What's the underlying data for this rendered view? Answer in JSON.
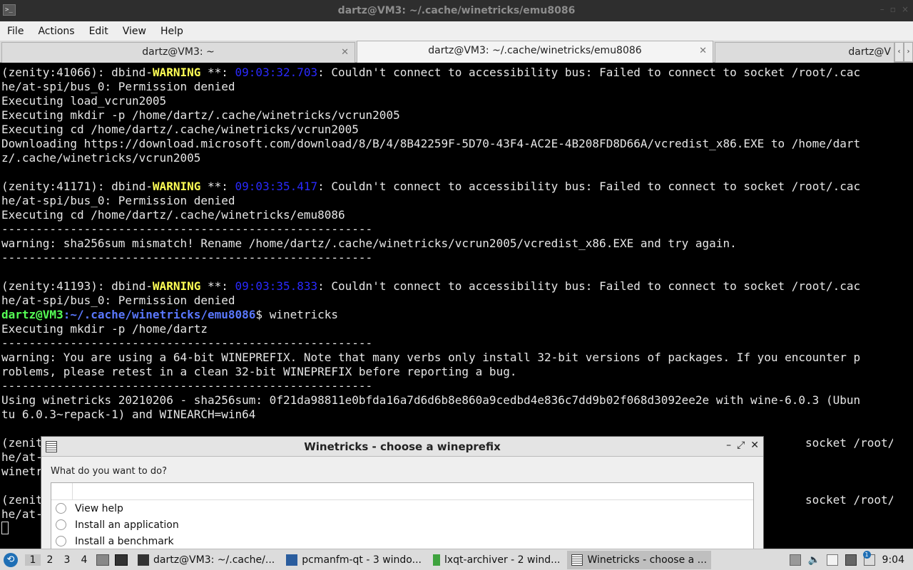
{
  "window": {
    "title": "dartz@VM3: ~/.cache/winetricks/emu8086",
    "buttons": [
      "–",
      "▫",
      "×"
    ]
  },
  "menu": [
    "File",
    "Actions",
    "Edit",
    "View",
    "Help"
  ],
  "tabs": [
    {
      "label": "dartz@VM3: ~",
      "active": false
    },
    {
      "label": "dartz@VM3: ~/.cache/winetricks/emu8086",
      "active": true
    },
    {
      "label": "dartz@V",
      "active": false
    }
  ],
  "terminal": {
    "lines": [
      "(zenity:41066): dbind-|WARNING| **: |09:03:32.703|: Couldn't connect to accessibility bus: Failed to connect to socket /root/.cac",
      "he/at-spi/bus_0: Permission denied",
      "Executing load_vcrun2005",
      "Executing mkdir -p /home/dartz/.cache/winetricks/vcrun2005",
      "Executing cd /home/dartz/.cache/winetricks/vcrun2005",
      "Downloading https://download.microsoft.com/download/8/B/4/8B42259F-5D70-43F4-AC2E-4B208FD8D66A/vcredist_x86.EXE to /home/dart",
      "z/.cache/winetricks/vcrun2005",
      "",
      "(zenity:41171): dbind-|WARNING| **: |09:03:35.417|: Couldn't connect to accessibility bus: Failed to connect to socket /root/.cac",
      "he/at-spi/bus_0: Permission denied",
      "Executing cd /home/dartz/.cache/winetricks/emu8086",
      "------------------------------------------------------",
      "warning: sha256sum mismatch! Rename /home/dartz/.cache/winetricks/vcrun2005/vcredist_x86.EXE and try again.",
      "------------------------------------------------------",
      "",
      "(zenity:41193): dbind-|WARNING| **: |09:03:35.833|: Couldn't connect to accessibility bus: Failed to connect to socket /root/.cac",
      "he/at-spi/bus_0: Permission denied",
      "PROMPT",
      "Executing mkdir -p /home/dartz",
      "------------------------------------------------------",
      "warning: You are using a 64-bit WINEPREFIX. Note that many verbs only install 32-bit versions of packages. If you encounter p",
      "roblems, please retest in a clean 32-bit WINEPREFIX before reporting a bug.",
      "------------------------------------------------------",
      "Using winetricks 20210206 - sha256sum: 0f21da98811e0bfda16a7d6d6b8e860a9cedbd4e836c7dd9b02f068d3092ee2e with wine-6.0.3 (Ubun",
      "tu 6.0.3~repack-1) and WINEARCH=win64",
      "",
      "(zenit                                                                                                               socket /root/.cac",
      "he/at-                                                                                                                           ",
      "winetr",
      "",
      "(zenit                                                                                                               socket /root/.cac",
      "he/at-"
    ],
    "prompt": {
      "user_host": "dartz@VM3",
      "path": ":~/.cache/winetricks/emu8086",
      "symbol": "$ ",
      "command": "winetricks"
    }
  },
  "dialog": {
    "title": "Winetricks - choose a wineprefix",
    "prompt": "What do you want to do?",
    "buttons": [
      "–",
      "⤢",
      "✕"
    ],
    "options": [
      "View help",
      "Install an application",
      "Install a benchmark"
    ]
  },
  "taskbar": {
    "desktops": [
      "1",
      "2",
      "3",
      "4"
    ],
    "tasks": [
      {
        "label": "dartz@VM3: ~/.cache/...",
        "icon": "terminal-icon",
        "active": false
      },
      {
        "label": "pcmanfm-qt - 3 windo...",
        "icon": "folder-icon",
        "active": false
      },
      {
        "label": "lxqt-archiver - 2 wind...",
        "icon": "archive-icon",
        "active": false
      },
      {
        "label": "Winetricks - choose a ...",
        "icon": "dialog-icon",
        "active": true
      }
    ],
    "clock": "9:04",
    "notification_badge": "1",
    "colors": {
      "start": "#1f6fb5",
      "folder": "#2a5d9e",
      "archive": "#3fa33f"
    }
  }
}
